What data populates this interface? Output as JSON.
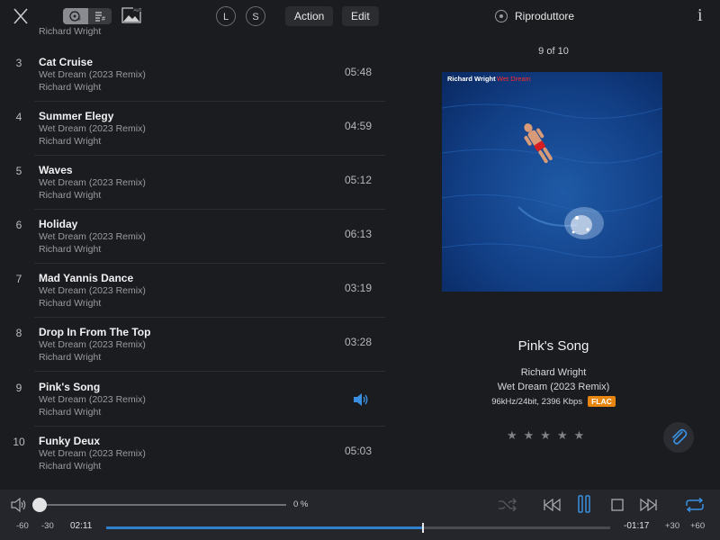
{
  "header": {
    "action_label": "Action",
    "edit_label": "Edit",
    "circle_l": "L",
    "circle_s": "S",
    "player_title": "Riproduttore",
    "info_label": "i"
  },
  "tracklist": {
    "previous_partial_artist": "Richard Wright",
    "tracks": [
      {
        "num": "3",
        "title": "Cat Cruise",
        "album": "Wet Dream (2023 Remix)",
        "artist": "Richard Wright",
        "duration": "05:48"
      },
      {
        "num": "4",
        "title": "Summer Elegy",
        "album": "Wet Dream (2023 Remix)",
        "artist": "Richard Wright",
        "duration": "04:59"
      },
      {
        "num": "5",
        "title": "Waves",
        "album": "Wet Dream (2023 Remix)",
        "artist": "Richard Wright",
        "duration": "05:12"
      },
      {
        "num": "6",
        "title": "Holiday",
        "album": "Wet Dream (2023 Remix)",
        "artist": "Richard Wright",
        "duration": "06:13"
      },
      {
        "num": "7",
        "title": "Mad Yannis Dance",
        "album": "Wet Dream (2023 Remix)",
        "artist": "Richard Wright",
        "duration": "03:19"
      },
      {
        "num": "8",
        "title": "Drop In From The Top",
        "album": "Wet Dream (2023 Remix)",
        "artist": "Richard Wright",
        "duration": "03:28"
      },
      {
        "num": "9",
        "title": "Pink's Song",
        "album": "Wet Dream (2023 Remix)",
        "artist": "Richard Wright",
        "duration": ""
      },
      {
        "num": "10",
        "title": "Funky Deux",
        "album": "Wet Dream (2023 Remix)",
        "artist": "Richard Wright",
        "duration": "05:03"
      }
    ]
  },
  "now_playing": {
    "counter": "9 of 10",
    "artwork_artist": "Richard Wright",
    "artwork_album": "Wet Dream",
    "title": "Pink's Song",
    "artist": "Richard Wright",
    "album": "Wet Dream (2023 Remix)",
    "format": "96kHz/24bit, 2396 Kbps",
    "format_badge": "FLAC",
    "rating_stars": 0,
    "stars_text": "★★★★★"
  },
  "transport": {
    "volume_percent": "0 %",
    "volume_fraction": 0,
    "skip_back_60": "-60",
    "skip_back_30": "-30",
    "elapsed": "02:11",
    "remaining": "-01:17",
    "skip_fwd_30": "+30",
    "skip_fwd_60": "+60",
    "progress_fraction": 0.628
  },
  "colors": {
    "accent": "#2f7fcc",
    "background": "#1b1c1f",
    "flac_badge": "#e8850e"
  }
}
